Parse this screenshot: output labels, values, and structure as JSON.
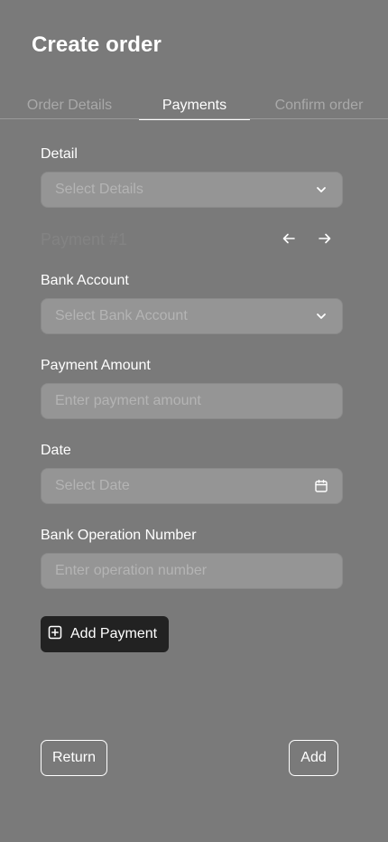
{
  "header": {
    "title": "Create order"
  },
  "tabs": [
    {
      "label": "Order Details",
      "active": false
    },
    {
      "label": "Payments",
      "active": true
    },
    {
      "label": "Confirm order",
      "active": false
    }
  ],
  "form": {
    "detail": {
      "label": "Detail",
      "placeholder": "Select Details",
      "icon": "chevron-down-icon"
    },
    "payment_section": {
      "title": "Payment #1",
      "prev_icon": "arrow-left-icon",
      "next_icon": "arrow-right-icon"
    },
    "bank_account": {
      "label": "Bank Account",
      "placeholder": "Select Bank Account",
      "icon": "chevron-down-icon"
    },
    "payment_amount": {
      "label": "Payment Amount",
      "placeholder": "Enter payment amount"
    },
    "date": {
      "label": "Date",
      "placeholder": "Select Date",
      "icon": "calendar-icon"
    },
    "operation_number": {
      "label": "Bank Operation Number",
      "placeholder": "Enter operation number"
    }
  },
  "actions": {
    "add_payment_label": "Add Payment",
    "add_payment_icon": "plus-square-icon",
    "return_label": "Return",
    "add_label": "Add"
  },
  "colors": {
    "background": "#7a7a7a",
    "field_background": "#959595",
    "primary_button": "#222222",
    "text": "#ffffff",
    "inactive_text": "#a9a9a9"
  }
}
